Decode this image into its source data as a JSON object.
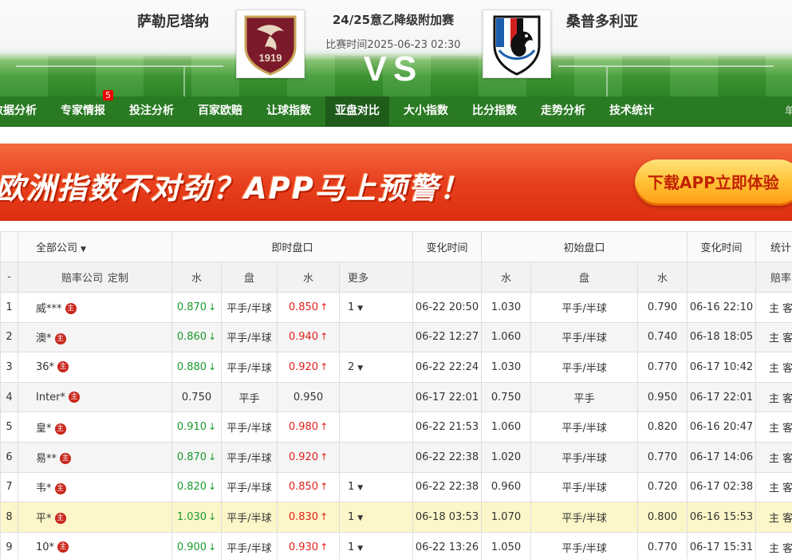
{
  "match": {
    "home_team": "萨勒尼塔纳",
    "away_team": "桑普多利亚",
    "competition": "24/25意乙降级附加赛",
    "match_time": "比赛时间2025-06-23 02:30",
    "vs": "VS",
    "home_logo_year": "1919"
  },
  "nav": {
    "items": [
      {
        "label": "数据分析"
      },
      {
        "label": "专家情报",
        "badge": "5"
      },
      {
        "label": "投注分析"
      },
      {
        "label": "百家欧赔"
      },
      {
        "label": "让球指数"
      },
      {
        "label": "亚盘对比"
      },
      {
        "label": "大小指数"
      },
      {
        "label": "比分指数"
      },
      {
        "label": "走势分析"
      },
      {
        "label": "技术统计"
      }
    ],
    "extra": "单",
    "active": "亚盘对比"
  },
  "banner": {
    "text": "欧洲指数不对劲？APP马上预警！",
    "button": "下载APP立即体验"
  },
  "table": {
    "header1": {
      "company_filter": "全部公司",
      "live_odds": "即时盘口",
      "change_time": "变化时间",
      "initial_odds": "初始盘口",
      "change_time2": "变化时间",
      "stats": "统计"
    },
    "header2": {
      "company": "赔率公司",
      "custom": "定制",
      "water": "水",
      "handicap": "盘",
      "water2": "水",
      "more": "更多",
      "init_water": "水",
      "init_handicap": "盘",
      "init_water2": "水",
      "stats_sub": "赔率"
    },
    "rows": [
      {
        "no": "1",
        "company": "威***",
        "w1": "0.870",
        "w1_dir": "down",
        "pan": "平手/半球",
        "w2": "0.850",
        "w2_dir": "up",
        "more": "1",
        "time": "06-22 20:50",
        "iw1": "1.030",
        "ipan": "平手/半球",
        "iw2": "0.790",
        "itime": "06-16 22:10",
        "stats": "主 客"
      },
      {
        "no": "2",
        "company": "澳*",
        "w1": "0.860",
        "w1_dir": "down",
        "pan": "平手/半球",
        "w2": "0.940",
        "w2_dir": "up",
        "more": "",
        "time": "06-22 12:27",
        "iw1": "1.060",
        "ipan": "平手/半球",
        "iw2": "0.740",
        "itime": "06-18 18:05",
        "stats": "主 客"
      },
      {
        "no": "3",
        "company": "36*",
        "w1": "0.880",
        "w1_dir": "down",
        "pan": "平手/半球",
        "w2": "0.920",
        "w2_dir": "up",
        "more": "2",
        "time": "06-22 22:24",
        "iw1": "1.030",
        "ipan": "平手/半球",
        "iw2": "0.770",
        "itime": "06-17 10:42",
        "stats": "主 客"
      },
      {
        "no": "4",
        "company": "Inter*",
        "w1": "0.750",
        "w1_dir": "",
        "pan": "平手",
        "w2": "0.950",
        "w2_dir": "",
        "more": "",
        "time": "06-17 22:01",
        "iw1": "0.750",
        "ipan": "平手",
        "iw2": "0.950",
        "itime": "06-17 22:01",
        "stats": "主 客"
      },
      {
        "no": "5",
        "company": "皇*",
        "w1": "0.910",
        "w1_dir": "down",
        "pan": "平手/半球",
        "w2": "0.980",
        "w2_dir": "up",
        "more": "",
        "time": "06-22 21:53",
        "iw1": "1.060",
        "ipan": "平手/半球",
        "iw2": "0.820",
        "itime": "06-16 20:47",
        "stats": "主 客"
      },
      {
        "no": "6",
        "company": "易**",
        "w1": "0.870",
        "w1_dir": "down",
        "pan": "平手/半球",
        "w2": "0.920",
        "w2_dir": "up",
        "more": "",
        "time": "06-22 22:38",
        "iw1": "1.020",
        "ipan": "平手/半球",
        "iw2": "0.770",
        "itime": "06-17 14:06",
        "stats": "主 客"
      },
      {
        "no": "7",
        "company": "韦*",
        "w1": "0.820",
        "w1_dir": "down",
        "pan": "平手/半球",
        "w2": "0.850",
        "w2_dir": "up",
        "more": "1",
        "time": "06-22 22:38",
        "iw1": "0.960",
        "ipan": "平手/半球",
        "iw2": "0.720",
        "itime": "06-17 02:38",
        "stats": "主 客"
      },
      {
        "no": "8",
        "company": "平*",
        "w1": "1.030",
        "w1_dir": "down",
        "pan": "平手/半球",
        "w2": "0.830",
        "w2_dir": "up",
        "more": "1",
        "time": "06-18 03:53",
        "iw1": "1.070",
        "ipan": "平手/半球",
        "iw2": "0.800",
        "itime": "06-16 15:53",
        "stats": "主 客",
        "highlight": true
      },
      {
        "no": "9",
        "company": "10*",
        "w1": "0.900",
        "w1_dir": "down",
        "pan": "平手/半球",
        "w2": "0.930",
        "w2_dir": "up",
        "more": "1",
        "time": "06-22 13:26",
        "iw1": "1.050",
        "ipan": "平手/半球",
        "iw2": "0.770",
        "itime": "06-17 15:31",
        "stats": "主 客"
      }
    ],
    "zhu_label": "主",
    "colors": {
      "up": "#e0201b",
      "down": "#1a9a2c",
      "highlight_row": "#fdf6c9"
    }
  }
}
